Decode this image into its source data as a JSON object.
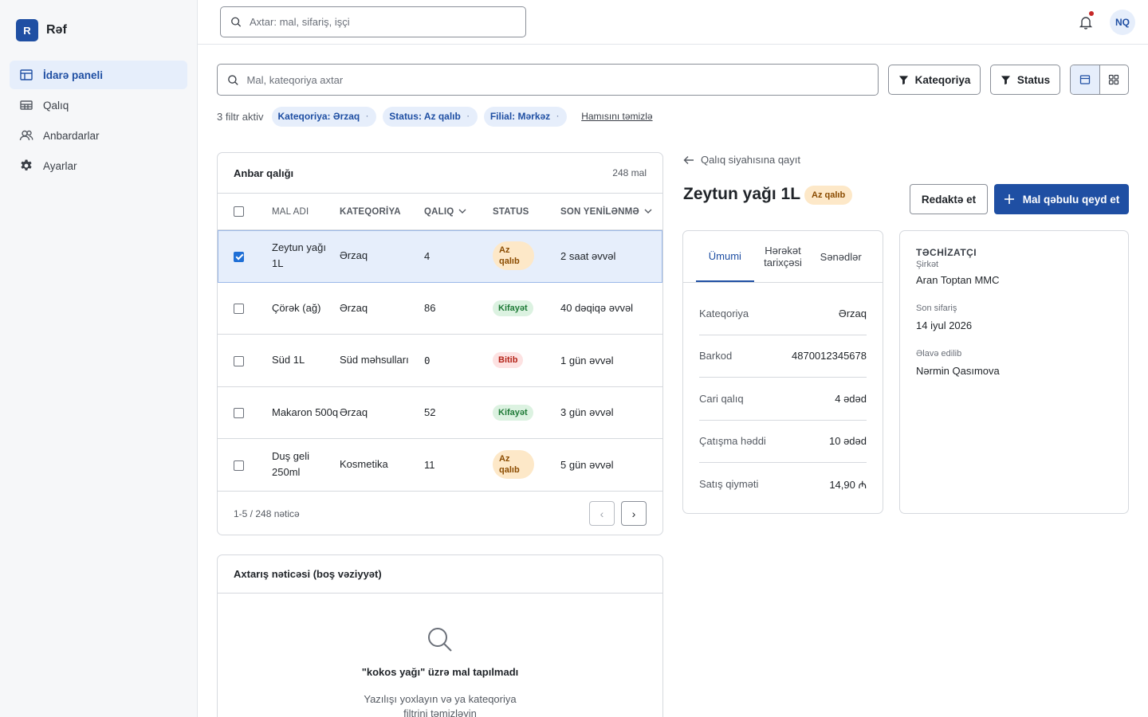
{
  "brand": {
    "logo_letter": "R",
    "name": "Rəf"
  },
  "sidebar": {
    "items": [
      {
        "label": "İdarə paneli",
        "icon": "dashboard-icon",
        "active": true
      },
      {
        "label": "Qalıq",
        "icon": "table-icon",
        "active": false
      },
      {
        "label": "Anbardarlar",
        "icon": "users-icon",
        "active": false
      },
      {
        "label": "Ayarlar",
        "icon": "gear-icon",
        "active": false
      }
    ]
  },
  "topbar": {
    "search_placeholder": "Axtar: mal, sifariş, işçi",
    "avatar_initials": "NQ",
    "notification_dot": true
  },
  "filters": {
    "search_placeholder": "Mal, kateqoriya axtar",
    "category_button": "Kateqoriya",
    "status_button": "Status",
    "active_count_text": "3 filtr aktiv",
    "chips": [
      "Kateqoriya: Ərzaq",
      "Status: Az qalıb",
      "Filial: Mərkəz"
    ],
    "chip_remove": "·",
    "clear_all": "Hamısını təmizlə"
  },
  "table": {
    "title": "Anbar qalığı",
    "count": "248 mal",
    "columns": {
      "name": "MAL ADI",
      "category": "KATEQORİYA",
      "qty": "QALIQ",
      "status": "STATUS",
      "updated": "SON YENİLƏNMƏ"
    },
    "rows": [
      {
        "name": "Zeytun yağı 1L",
        "category": "Ərzaq",
        "qty": "4",
        "status": "Az qalıb",
        "updated": "2 saat əvvəl"
      },
      {
        "name": "Çörək (ağ)",
        "category": "Ərzaq",
        "qty": "86",
        "status": "Kifayət",
        "updated": "40 dəqiqə əvvəl"
      },
      {
        "name": "Süd 1L",
        "category": "Süd məhsulları",
        "qty": "0",
        "status": "Bitib",
        "updated": "1 gün əvvəl"
      },
      {
        "name": "Makaron 500q",
        "category": "Ərzaq",
        "qty": "52",
        "status": "Kifayət",
        "updated": "3 gün əvvəl"
      },
      {
        "name": "Duş geli 250ml",
        "category": "Kosmetika",
        "qty": "11",
        "status": "Az qalıb",
        "updated": "5 gün əvvəl"
      }
    ],
    "pager_text": "1-5 / 248 nəticə",
    "prev": "‹",
    "next": "›"
  },
  "empty_state": {
    "title": "Axtarış nəticəsi (boş vəziyyət)",
    "message": "\"kokos yağı\" üzrə mal tapılmadı",
    "hint": "Yazılışı yoxlayın və ya kateqoriya filtrini təmizləyin"
  },
  "detail": {
    "back_link": "Qalıq siyahısına qayıt",
    "title": "Zeytun yağı 1L",
    "badge": "Az qalıb",
    "edit_button": "Redaktə et",
    "primary_button": "Mal qəbulu qeyd et",
    "tabs": [
      "Ümumi",
      "Hərəkət tarixçəsi",
      "Sənədlər"
    ],
    "fields": [
      {
        "k": "Kateqoriya",
        "v": "Ərzaq"
      },
      {
        "k": "Barkod",
        "v": "4870012345678"
      },
      {
        "k": "Cari qalıq",
        "v": "4 ədəd"
      },
      {
        "k": "Çatışma həddi",
        "v": "10 ədəd"
      },
      {
        "k": "Satış qiyməti",
        "v": "14,90 ₼"
      }
    ]
  },
  "supplier": {
    "title": "TƏCHİZATÇI",
    "company_label": "Şirkət",
    "company": "Aran Toptan MMC",
    "last_order_label": "Son sifariş",
    "last_order": "14 iyul 2026",
    "added_by_label": "Əlavə edilib",
    "added_by": "Nərmin Qasımova"
  },
  "colors": {
    "accent": "#1f4fa3",
    "selected_row": "#e6eefb",
    "low": "#fde8c8",
    "ok": "#dcf2e1",
    "out": "#fde2e2"
  }
}
